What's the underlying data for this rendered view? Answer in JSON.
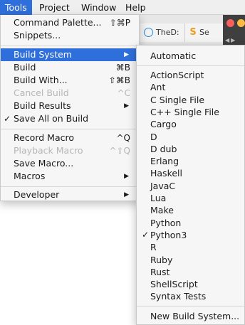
{
  "menubar": {
    "items": [
      "Tools",
      "Project",
      "Window",
      "Help"
    ]
  },
  "background_tabs": [
    "TheD:",
    "Se"
  ],
  "tools_menu": {
    "command_palette": {
      "label": "Command Palette...",
      "shortcut": "⇧⌘P"
    },
    "snippets": {
      "label": "Snippets..."
    },
    "build_system": {
      "label": "Build System",
      "arrow": "▶"
    },
    "build": {
      "label": "Build",
      "shortcut": "⌘B"
    },
    "build_with": {
      "label": "Build With...",
      "shortcut": "⇧⌘B"
    },
    "cancel_build": {
      "label": "Cancel Build",
      "shortcut": "^C"
    },
    "build_results": {
      "label": "Build Results",
      "arrow": "▶"
    },
    "save_all_on_build": {
      "label": "Save All on Build",
      "check": "✓"
    },
    "record_macro": {
      "label": "Record Macro",
      "shortcut": "^Q"
    },
    "playback_macro": {
      "label": "Playback Macro",
      "shortcut": "^⇧Q"
    },
    "save_macro": {
      "label": "Save Macro..."
    },
    "macros": {
      "label": "Macros",
      "arrow": "▶"
    },
    "developer": {
      "label": "Developer",
      "arrow": "▶"
    }
  },
  "build_system_menu": {
    "automatic": "Automatic",
    "items": [
      "ActionScript",
      "Ant",
      "C Single File",
      "C++ Single File",
      "Cargo",
      "D",
      "D dub",
      "Erlang",
      "Haskell",
      "JavaC",
      "Lua",
      "Make",
      "Python",
      "Python3",
      "R",
      "Ruby",
      "Rust",
      "ShellScript",
      "Syntax Tests"
    ],
    "checked_item": "Python3",
    "check": "✓",
    "new_build_system": "New Build System..."
  },
  "colors": {
    "highlight": "#2f6fdb",
    "disabled": "#b6b6b6",
    "menu_bg": "#f6f6f6"
  }
}
